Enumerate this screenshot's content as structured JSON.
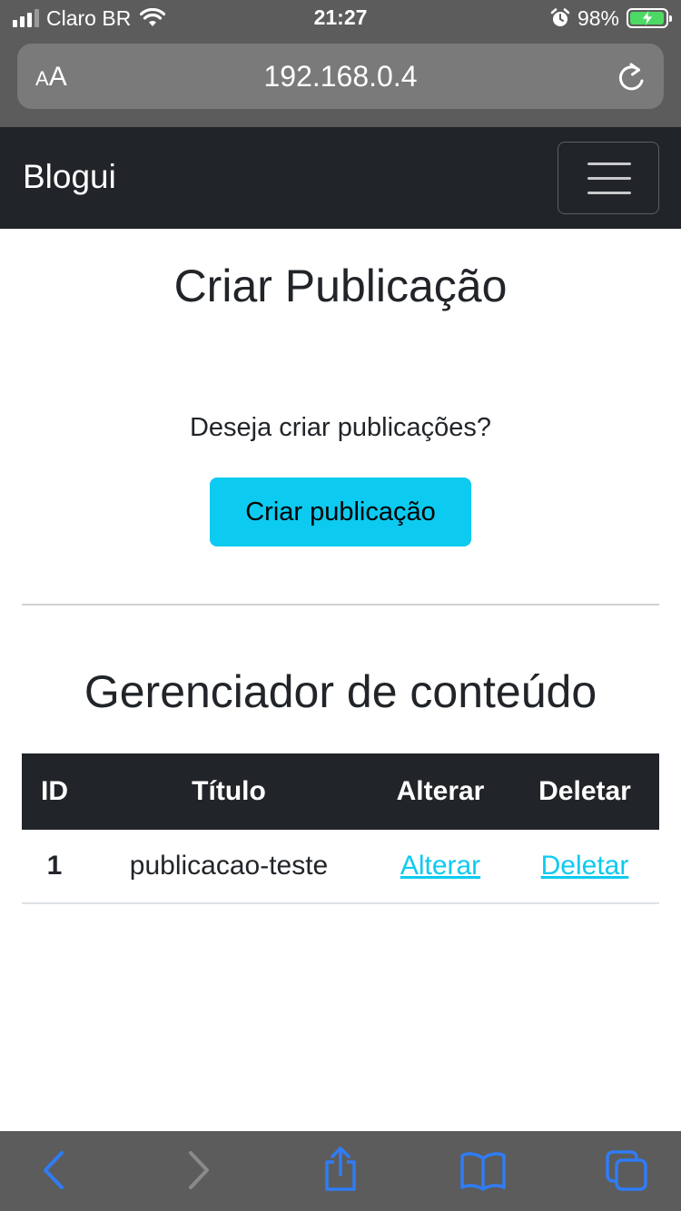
{
  "status_bar": {
    "carrier": "Claro BR",
    "time": "21:27",
    "battery_percent": "98%",
    "battery_level": 0.98,
    "signal_bars": 4,
    "signal_bars_active": 3
  },
  "address_bar": {
    "text_size_small": "A",
    "text_size_big": "A",
    "url": "192.168.0.4"
  },
  "navbar": {
    "brand": "Blogui"
  },
  "create_section": {
    "title": "Criar Publicação",
    "question": "Deseja criar publicações?",
    "button_label": "Criar publicação"
  },
  "manager_section": {
    "title": "Gerenciador de conteúdo",
    "columns": [
      "ID",
      "Título",
      "Alterar",
      "Deletar"
    ],
    "rows": [
      {
        "id": "1",
        "title": "publicacao-teste",
        "edit_link": "Alterar",
        "delete_link": "Deletar"
      }
    ]
  },
  "colors": {
    "navbar_bg": "#212529",
    "button_bg": "#0dcaf0",
    "link": "#0dcaf0",
    "ios_toolbar_bg": "#5c5c5c",
    "ios_accent": "#2f7cf6",
    "battery_green": "#4cd964"
  },
  "toolbar": {
    "icons": [
      "back-icon",
      "forward-icon",
      "share-icon",
      "bookmarks-icon",
      "tabs-icon"
    ],
    "forward_enabled": false
  }
}
